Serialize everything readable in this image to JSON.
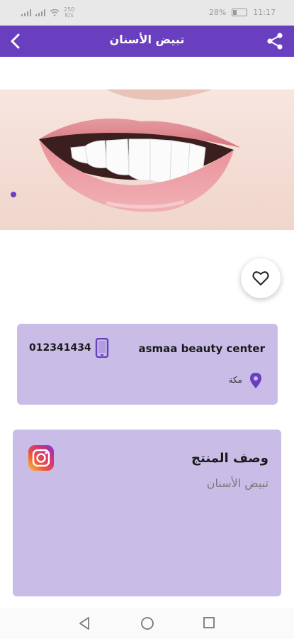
{
  "status_bar": {
    "network_speed_top": "250",
    "network_speed_unit": "K/s",
    "battery": "28%",
    "time": "11:17"
  },
  "app_bar": {
    "title": "تبيض الأسنان",
    "back_icon": "chevron-left-icon",
    "share_icon": "share-icon"
  },
  "banner": {
    "image": "smiling mouth with white teeth",
    "active_slide": 1
  },
  "favorite": {
    "icon": "heart-outline-icon"
  },
  "info": {
    "shop_name": "asmaa beauty center",
    "phone": "012341434",
    "city": "مكة",
    "phone_icon": "mobile-phone-icon",
    "location_icon": "location-pin-icon"
  },
  "description": {
    "title": "وصف المنتج",
    "text": "تبيض الأسنان",
    "social_icon": "instagram-icon"
  },
  "nav": {
    "back_icon": "nav-back-icon",
    "home_icon": "nav-home-icon",
    "recent_icon": "nav-recent-icon"
  },
  "colors": {
    "primary": "#6a3fbf",
    "card": "#c9bde8",
    "status_bar": "#e8e8e8"
  }
}
